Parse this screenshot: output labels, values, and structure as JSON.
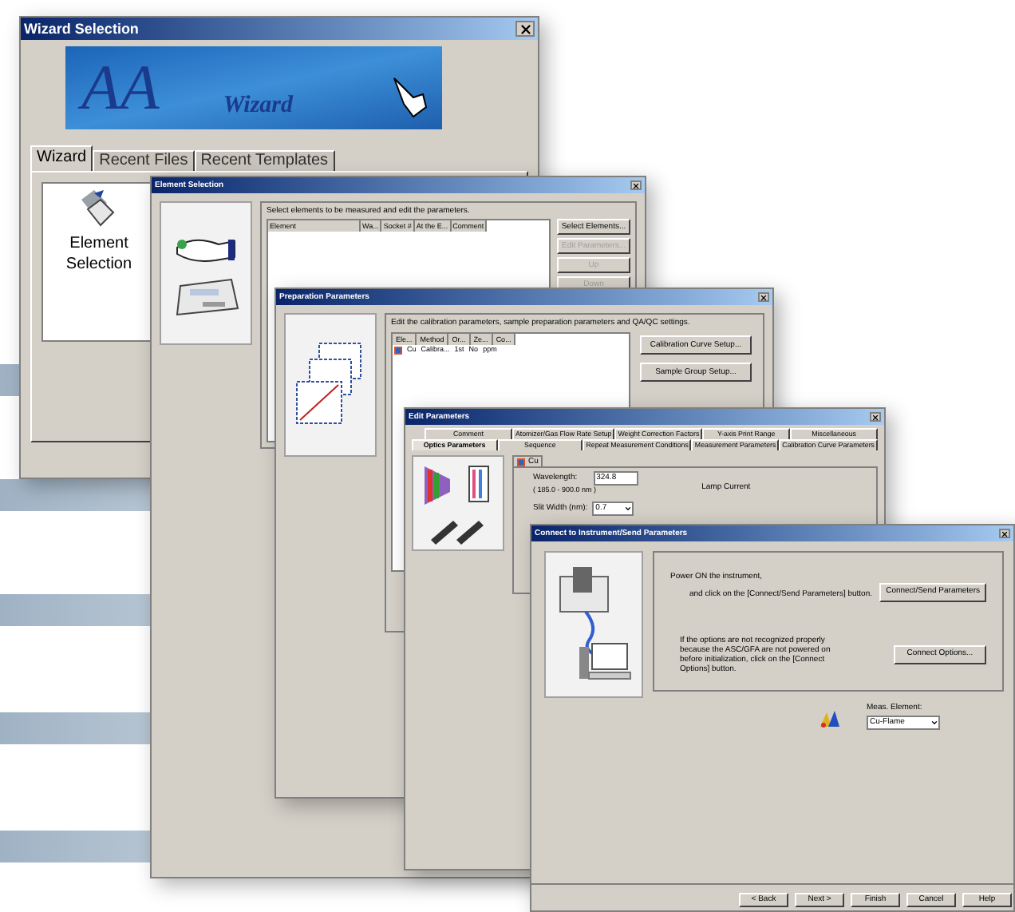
{
  "wizard_selection": {
    "title": "Wizard Selection",
    "banner": {
      "logo": "AA",
      "subtitle": "Wizard"
    },
    "tabs": [
      {
        "label": "Wizard",
        "selected": true
      },
      {
        "label": "Recent Files",
        "selected": false
      },
      {
        "label": "Recent Templates",
        "selected": false
      }
    ],
    "items": [
      {
        "label": "Element Selection"
      }
    ]
  },
  "element_selection": {
    "title": "Element Selection",
    "instruction": "Select elements to be measured and edit the parameters.",
    "columns": [
      "Element",
      "Wa...",
      "Socket #",
      "At the E...",
      "Comment"
    ],
    "buttons": [
      {
        "label": "Select Elements...",
        "disabled": false
      },
      {
        "label": "Edit Parameters...",
        "disabled": true
      },
      {
        "label": "Up",
        "disabled": true
      },
      {
        "label": "Down",
        "disabled": true
      }
    ]
  },
  "preparation_parameters": {
    "title": "Preparation Parameters",
    "instruction": "Edit the calibration parameters, sample preparation parameters and QA/QC settings.",
    "columns": [
      "Ele...",
      "Method",
      "Or...",
      "Ze...",
      "Co..."
    ],
    "rows": [
      [
        "Cu",
        "Calibra...",
        "1st",
        "No",
        "ppm"
      ]
    ],
    "buttons": [
      "Calibration Curve Setup...",
      "Sample Group Setup..."
    ]
  },
  "edit_parameters": {
    "title": "Edit Parameters",
    "tab_rows": [
      [
        {
          "label": "Comment",
          "selected": false
        },
        {
          "label": "Atomizer/Gas Flow Rate Setup",
          "selected": false
        },
        {
          "label": "Weight Correction Factors",
          "selected": false
        },
        {
          "label": "Y-axis Print Range",
          "selected": false
        },
        {
          "label": "Miscellaneous",
          "selected": false
        }
      ],
      [
        {
          "label": "Optics Parameters",
          "selected": true
        },
        {
          "label": "Sequence",
          "selected": false
        },
        {
          "label": "Repeat Measurement Conditions",
          "selected": false
        },
        {
          "label": "Measurement Parameters",
          "selected": false
        },
        {
          "label": "Calibration Curve Parameters",
          "selected": false
        }
      ]
    ],
    "element_tab": "Cu",
    "wavelength": {
      "label": "Wavelength:",
      "value": "324.8",
      "range": "( 185.0 - 900.0 nm )"
    },
    "lamp_current": "Lamp Current",
    "slit_width": {
      "label": "Slit Width (nm):",
      "value": "0.7"
    }
  },
  "connect": {
    "title": "Connect to Instrument/Send Parameters",
    "step1": "Power ON the instrument,",
    "step2": "and click on the [Connect/Send Parameters] button.",
    "connect_button": "Connect/Send Parameters",
    "options_note": "If the options are not recognized properly because the ASC/GFA are not powered on before initialization, click on the [Connect Options] button.",
    "options_button": "Connect Options...",
    "meas_element": {
      "label": "Meas. Element:",
      "value": "Cu-Flame"
    },
    "nav_buttons": [
      "< Back",
      "Next >",
      "Finish",
      "Cancel",
      "Help"
    ]
  }
}
